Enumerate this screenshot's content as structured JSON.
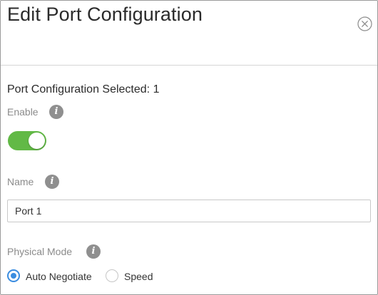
{
  "dialog": {
    "title": "Edit Port Configuration",
    "close_icon": "close-circle-icon"
  },
  "form": {
    "section_title": "Port Configuration Selected: 1",
    "info_glyph": "i",
    "enable": {
      "label": "Enable",
      "value": true,
      "on_color": "#62b946"
    },
    "name": {
      "label": "Name",
      "value": "Port 1"
    },
    "physical_mode": {
      "label": "Physical Mode",
      "options": [
        {
          "label": "Auto Negotiate",
          "selected": true
        },
        {
          "label": "Speed",
          "selected": false
        }
      ],
      "selected_color": "#3b8de0"
    }
  }
}
